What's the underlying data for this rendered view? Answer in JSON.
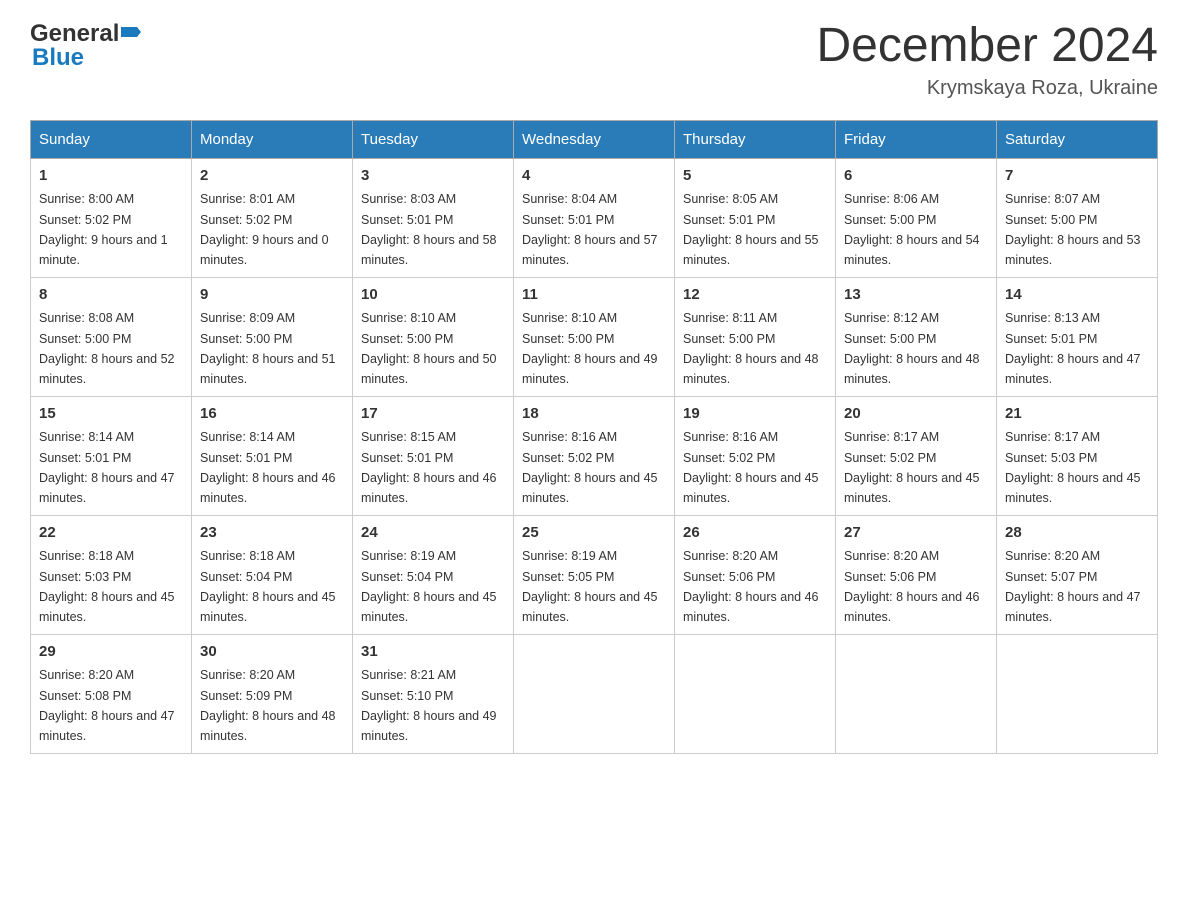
{
  "header": {
    "month_year": "December 2024",
    "location": "Krymskaya Roza, Ukraine",
    "logo_general": "General",
    "logo_blue": "Blue"
  },
  "days_of_week": [
    "Sunday",
    "Monday",
    "Tuesday",
    "Wednesday",
    "Thursday",
    "Friday",
    "Saturday"
  ],
  "weeks": [
    [
      {
        "day": "1",
        "sunrise": "8:00 AM",
        "sunset": "5:02 PM",
        "daylight": "9 hours and 1 minute."
      },
      {
        "day": "2",
        "sunrise": "8:01 AM",
        "sunset": "5:02 PM",
        "daylight": "9 hours and 0 minutes."
      },
      {
        "day": "3",
        "sunrise": "8:03 AM",
        "sunset": "5:01 PM",
        "daylight": "8 hours and 58 minutes."
      },
      {
        "day": "4",
        "sunrise": "8:04 AM",
        "sunset": "5:01 PM",
        "daylight": "8 hours and 57 minutes."
      },
      {
        "day": "5",
        "sunrise": "8:05 AM",
        "sunset": "5:01 PM",
        "daylight": "8 hours and 55 minutes."
      },
      {
        "day": "6",
        "sunrise": "8:06 AM",
        "sunset": "5:00 PM",
        "daylight": "8 hours and 54 minutes."
      },
      {
        "day": "7",
        "sunrise": "8:07 AM",
        "sunset": "5:00 PM",
        "daylight": "8 hours and 53 minutes."
      }
    ],
    [
      {
        "day": "8",
        "sunrise": "8:08 AM",
        "sunset": "5:00 PM",
        "daylight": "8 hours and 52 minutes."
      },
      {
        "day": "9",
        "sunrise": "8:09 AM",
        "sunset": "5:00 PM",
        "daylight": "8 hours and 51 minutes."
      },
      {
        "day": "10",
        "sunrise": "8:10 AM",
        "sunset": "5:00 PM",
        "daylight": "8 hours and 50 minutes."
      },
      {
        "day": "11",
        "sunrise": "8:10 AM",
        "sunset": "5:00 PM",
        "daylight": "8 hours and 49 minutes."
      },
      {
        "day": "12",
        "sunrise": "8:11 AM",
        "sunset": "5:00 PM",
        "daylight": "8 hours and 48 minutes."
      },
      {
        "day": "13",
        "sunrise": "8:12 AM",
        "sunset": "5:00 PM",
        "daylight": "8 hours and 48 minutes."
      },
      {
        "day": "14",
        "sunrise": "8:13 AM",
        "sunset": "5:01 PM",
        "daylight": "8 hours and 47 minutes."
      }
    ],
    [
      {
        "day": "15",
        "sunrise": "8:14 AM",
        "sunset": "5:01 PM",
        "daylight": "8 hours and 47 minutes."
      },
      {
        "day": "16",
        "sunrise": "8:14 AM",
        "sunset": "5:01 PM",
        "daylight": "8 hours and 46 minutes."
      },
      {
        "day": "17",
        "sunrise": "8:15 AM",
        "sunset": "5:01 PM",
        "daylight": "8 hours and 46 minutes."
      },
      {
        "day": "18",
        "sunrise": "8:16 AM",
        "sunset": "5:02 PM",
        "daylight": "8 hours and 45 minutes."
      },
      {
        "day": "19",
        "sunrise": "8:16 AM",
        "sunset": "5:02 PM",
        "daylight": "8 hours and 45 minutes."
      },
      {
        "day": "20",
        "sunrise": "8:17 AM",
        "sunset": "5:02 PM",
        "daylight": "8 hours and 45 minutes."
      },
      {
        "day": "21",
        "sunrise": "8:17 AM",
        "sunset": "5:03 PM",
        "daylight": "8 hours and 45 minutes."
      }
    ],
    [
      {
        "day": "22",
        "sunrise": "8:18 AM",
        "sunset": "5:03 PM",
        "daylight": "8 hours and 45 minutes."
      },
      {
        "day": "23",
        "sunrise": "8:18 AM",
        "sunset": "5:04 PM",
        "daylight": "8 hours and 45 minutes."
      },
      {
        "day": "24",
        "sunrise": "8:19 AM",
        "sunset": "5:04 PM",
        "daylight": "8 hours and 45 minutes."
      },
      {
        "day": "25",
        "sunrise": "8:19 AM",
        "sunset": "5:05 PM",
        "daylight": "8 hours and 45 minutes."
      },
      {
        "day": "26",
        "sunrise": "8:20 AM",
        "sunset": "5:06 PM",
        "daylight": "8 hours and 46 minutes."
      },
      {
        "day": "27",
        "sunrise": "8:20 AM",
        "sunset": "5:06 PM",
        "daylight": "8 hours and 46 minutes."
      },
      {
        "day": "28",
        "sunrise": "8:20 AM",
        "sunset": "5:07 PM",
        "daylight": "8 hours and 47 minutes."
      }
    ],
    [
      {
        "day": "29",
        "sunrise": "8:20 AM",
        "sunset": "5:08 PM",
        "daylight": "8 hours and 47 minutes."
      },
      {
        "day": "30",
        "sunrise": "8:20 AM",
        "sunset": "5:09 PM",
        "daylight": "8 hours and 48 minutes."
      },
      {
        "day": "31",
        "sunrise": "8:21 AM",
        "sunset": "5:10 PM",
        "daylight": "8 hours and 49 minutes."
      },
      null,
      null,
      null,
      null
    ]
  ],
  "labels": {
    "sunrise": "Sunrise:",
    "sunset": "Sunset:",
    "daylight": "Daylight:"
  }
}
